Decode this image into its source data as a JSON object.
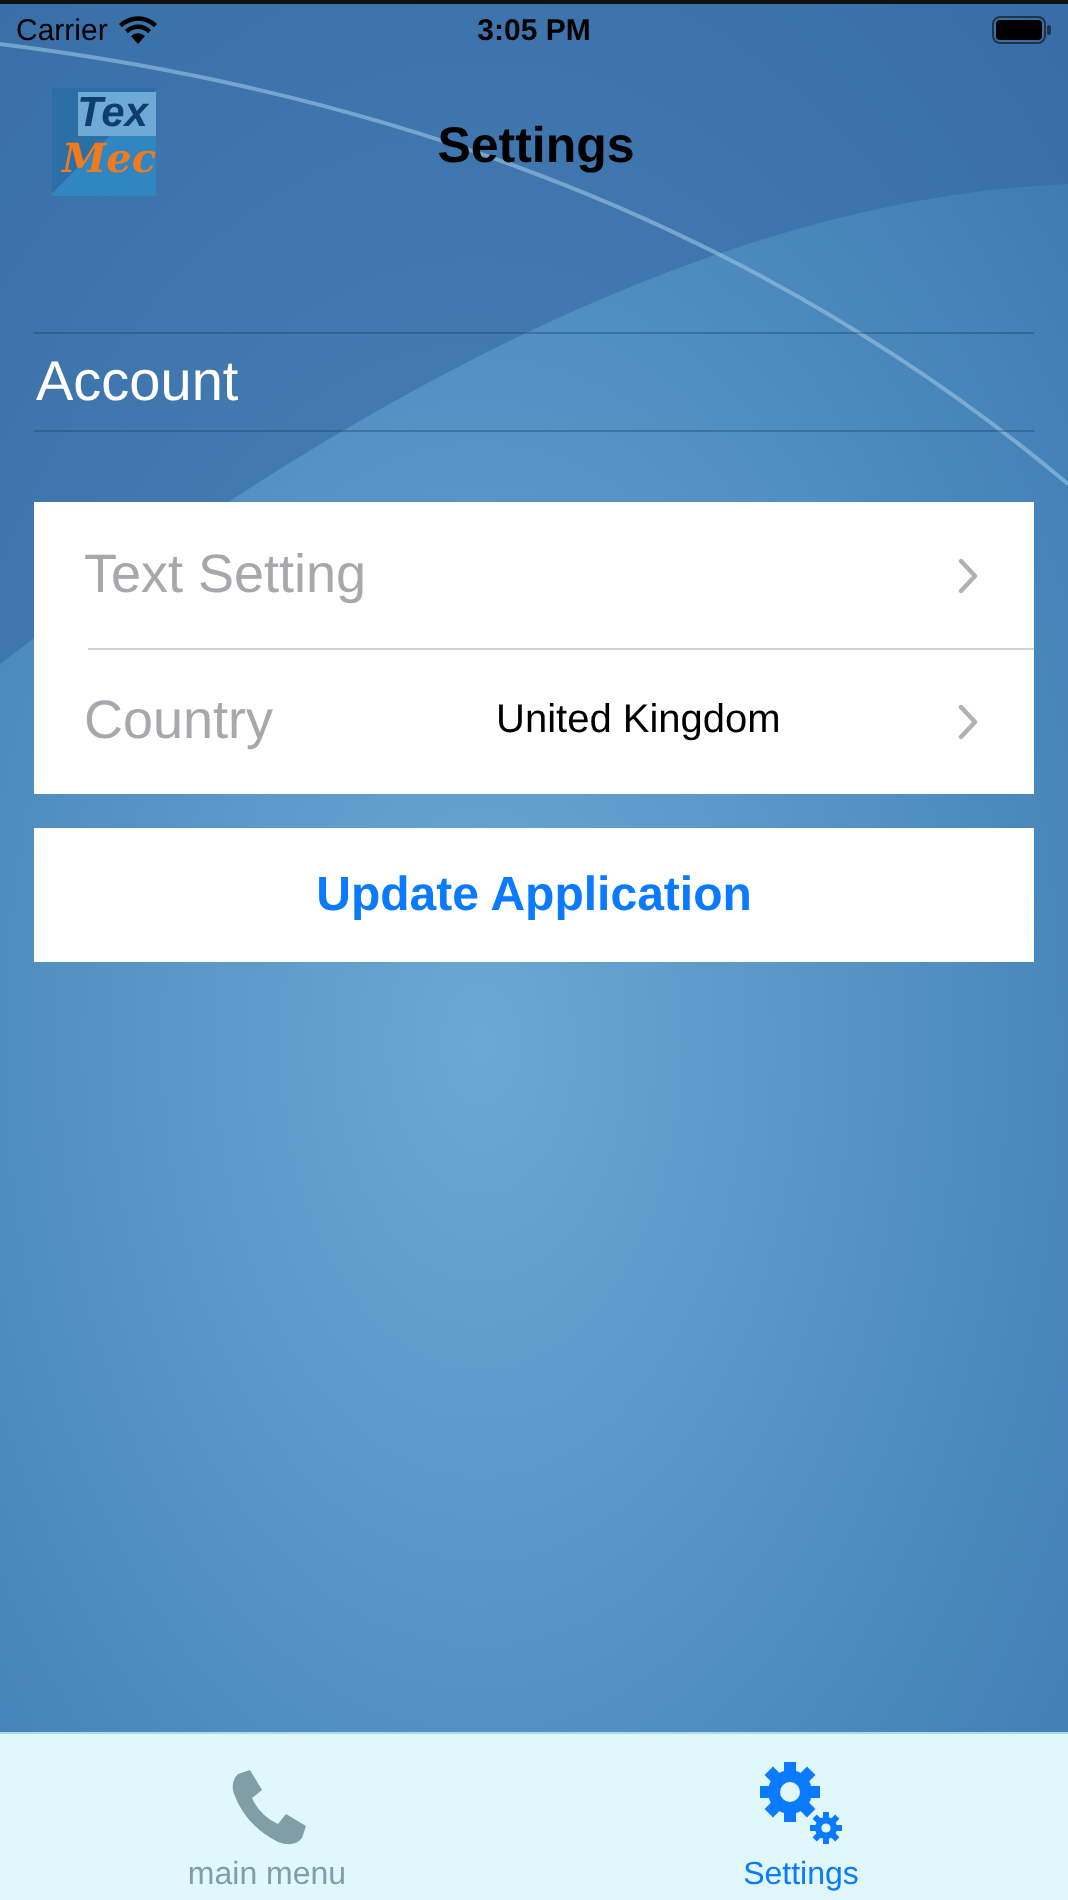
{
  "status_bar": {
    "carrier": "Carrier",
    "time": "3:05 PM"
  },
  "logo": {
    "line_1": "Tex",
    "line_2": "Mec"
  },
  "nav": {
    "title": "Settings"
  },
  "section": {
    "title": "Account"
  },
  "settings": [
    {
      "label": "Text Setting"
    },
    {
      "label": "Country",
      "value": "United Kingdom"
    }
  ],
  "update_button": "Update Application",
  "tabs": [
    {
      "label": "main menu",
      "kind": "phone",
      "selected": false
    },
    {
      "label": "Settings",
      "kind": "gear",
      "selected": true
    }
  ]
}
